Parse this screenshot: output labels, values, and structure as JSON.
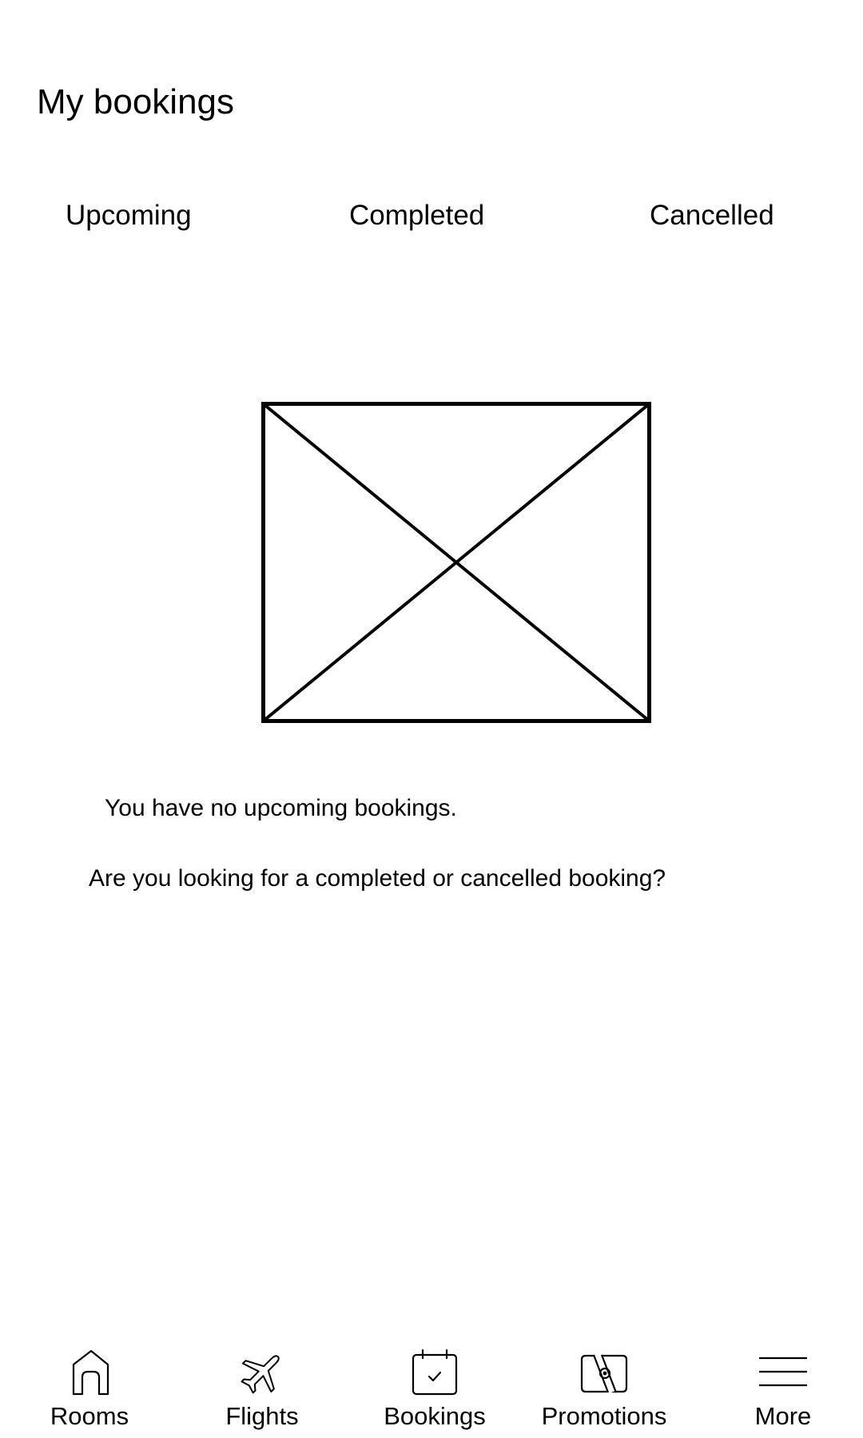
{
  "header": {
    "title": "My bookings"
  },
  "tabs": [
    {
      "label": "Upcoming"
    },
    {
      "label": "Completed"
    },
    {
      "label": "Cancelled"
    }
  ],
  "main": {
    "empty_message": "You have no upcoming bookings.",
    "help_message": "Are you looking for a completed or cancelled booking?"
  },
  "bottom_nav": [
    {
      "label": "Rooms",
      "icon": "home-icon"
    },
    {
      "label": "Flights",
      "icon": "airplane-icon"
    },
    {
      "label": "Bookings",
      "icon": "calendar-check-icon"
    },
    {
      "label": "Promotions",
      "icon": "promotion-ticket-icon"
    },
    {
      "label": "More",
      "icon": "menu-icon"
    }
  ]
}
